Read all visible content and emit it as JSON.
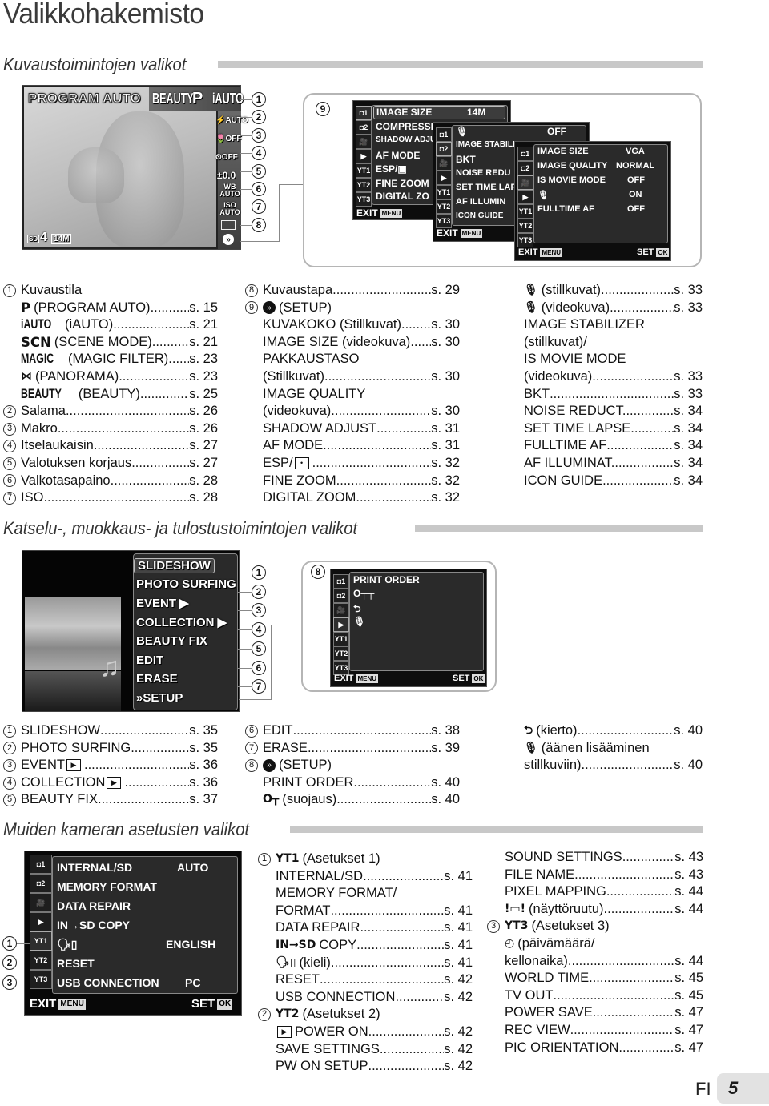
{
  "page_title": "Valikkohakemisto",
  "sections": {
    "shooting": "Kuvaustoimintojen valikot",
    "playback": "Katselu-, muokkaus- ja tulostustoimintojen valikot",
    "settings": "Muiden kameran asetusten valikot"
  },
  "shooting_screen": {
    "mode_label": "PROGRAM AUTO",
    "mode_icons": [
      "BEAUTY",
      "P",
      "iAUTO"
    ],
    "side_items": [
      "⚡AUTO",
      "🌷OFF",
      "⏲OFF",
      "±0.0",
      "WB AUTO",
      "ISO AUTO",
      "▭",
      "»"
    ],
    "bottom_status": [
      "SD",
      "4",
      "14M"
    ],
    "callouts": [
      "1",
      "2",
      "3",
      "4",
      "5",
      "6",
      "7",
      "8"
    ]
  },
  "setup_menus": {
    "callout": "9",
    "tabs": [
      "◘1",
      "◘2",
      "🎥",
      "▶",
      "YT1",
      "YT2",
      "YT3"
    ],
    "menu1": {
      "rows": [
        {
          "label": "IMAGE SIZE",
          "value": "14M"
        },
        {
          "label": "COMPRESSI",
          "value": ""
        },
        {
          "label": "SHADOW ADJU",
          "value": ""
        },
        {
          "label": "AF MODE",
          "value": ""
        },
        {
          "label": "ESP/▣",
          "value": ""
        },
        {
          "label": "FINE ZOOM",
          "value": ""
        },
        {
          "label": "DIGITAL ZO",
          "value": ""
        }
      ],
      "exit": "EXIT",
      "menu_key": "MENU"
    },
    "menu2": {
      "rows": [
        {
          "label": "🎙",
          "value": "OFF"
        },
        {
          "label": "IMAGE STABILD",
          "value": ""
        },
        {
          "label": "BKT",
          "value": ""
        },
        {
          "label": "NOISE REDU",
          "value": ""
        },
        {
          "label": "SET TIME LAF",
          "value": ""
        },
        {
          "label": "AF ILLUMIN",
          "value": ""
        },
        {
          "label": "ICON GUIDE",
          "value": ""
        }
      ],
      "exit": "EXIT",
      "menu_key": "MENU"
    },
    "menu3": {
      "rows": [
        {
          "label": "IMAGE SIZE",
          "value": "VGA"
        },
        {
          "label": "IMAGE QUALITY",
          "value": "NORMAL"
        },
        {
          "label": "IS MOVIE MODE",
          "value": "OFF"
        },
        {
          "label": "🎙",
          "value": "ON"
        },
        {
          "label": "FULLTIME AF",
          "value": "OFF"
        }
      ],
      "exit": "EXIT",
      "menu_key": "MENU",
      "set": "SET",
      "ok_key": "OK"
    }
  },
  "shooting_refs": {
    "col1": [
      {
        "num": "1",
        "label": "Kuvaustila",
        "page": ""
      },
      {
        "icon": "P",
        "label": "(PROGRAM AUTO)",
        "page": "s. 15"
      },
      {
        "icon": "iAUTO",
        "label": "(iAUTO)",
        "page": "s. 21"
      },
      {
        "icon": "SCN",
        "label": "(SCENE MODE)",
        "page": "s. 21"
      },
      {
        "icon": "MAGIC",
        "label": "(MAGIC FILTER)",
        "page": "s. 23"
      },
      {
        "icon": "⋈",
        "label": "(PANORAMA)",
        "page": "s. 23"
      },
      {
        "icon": "BEAUTY",
        "label": "(BEAUTY)",
        "page": "s. 25"
      },
      {
        "num": "2",
        "label": "Salama",
        "page": "s. 26"
      },
      {
        "num": "3",
        "label": "Makro",
        "page": "s. 26"
      },
      {
        "num": "4",
        "label": "Itselaukaisin",
        "page": "s. 27"
      },
      {
        "num": "5",
        "label": "Valotuksen korjaus",
        "page": "s. 27"
      },
      {
        "num": "6",
        "label": "Valkotasapaino",
        "page": "s. 28"
      },
      {
        "num": "7",
        "label": "ISO",
        "page": "s. 28"
      }
    ],
    "col2": [
      {
        "num": "8",
        "label": "Kuvaustapa",
        "page": "s. 29"
      },
      {
        "num": "9",
        "icon": "»",
        "label": "(SETUP)",
        "page": ""
      },
      {
        "label": "KUVAKOKO (Stillkuvat)",
        "page": "s. 30"
      },
      {
        "label": "IMAGE SIZE (videokuva)",
        "page": "s. 30"
      },
      {
        "label": "PAKKAUSTASO",
        "page": ""
      },
      {
        "label": "(Stillkuvat)",
        "page": "s. 30"
      },
      {
        "label": "IMAGE QUALITY",
        "page": ""
      },
      {
        "label": "(videokuva)",
        "page": "s. 30"
      },
      {
        "label": "SHADOW ADJUST",
        "page": "s. 31"
      },
      {
        "label": "AF MODE",
        "page": "s. 31"
      },
      {
        "label": "ESP/",
        "icon_after": "•",
        "page": "s. 32"
      },
      {
        "label": "FINE ZOOM",
        "page": "s. 32"
      },
      {
        "label": "DIGITAL ZOOM",
        "page": "s. 32"
      }
    ],
    "col3": [
      {
        "icon": "🎙",
        "label": "(stillkuvat)",
        "page": "s. 33"
      },
      {
        "icon": "🎙",
        "label": "(videokuva)",
        "page": "s. 33"
      },
      {
        "label": "IMAGE STABILIZER",
        "page": ""
      },
      {
        "label": "(stillkuvat)/",
        "page": ""
      },
      {
        "label": "IS MOVIE MODE",
        "page": ""
      },
      {
        "label": "(videokuva)",
        "page": "s. 33"
      },
      {
        "label": "BKT",
        "page": "s. 33"
      },
      {
        "label": "NOISE REDUCT.",
        "page": "s. 34"
      },
      {
        "label": "SET TIME LAPSE",
        "page": "s. 34"
      },
      {
        "label": "FULLTIME AF",
        "page": "s. 34"
      },
      {
        "label": "AF ILLUMINAT.",
        "page": "s. 34"
      },
      {
        "label": "ICON GUIDE",
        "page": "s. 34"
      }
    ]
  },
  "playback_screen": {
    "items": [
      "SLIDESHOW",
      "PHOTO SURFING",
      "EVENT ▶",
      "COLLECTION ▶",
      "BEAUTY FIX",
      "EDIT",
      "ERASE",
      "»SETUP"
    ],
    "callouts": [
      "1",
      "2",
      "3",
      "4",
      "5",
      "6",
      "7"
    ]
  },
  "playback_setup_menu": {
    "callout": "8",
    "tabs": [
      "◘1",
      "◘2",
      "🎥",
      "▶",
      "YT1",
      "YT2",
      "YT3"
    ],
    "rows": [
      "PRINT ORDER",
      "O┬┬",
      "⮌",
      "🎙"
    ],
    "exit": "EXIT",
    "menu_key": "MENU",
    "set": "SET",
    "ok_key": "OK"
  },
  "playback_refs": {
    "col1": [
      {
        "num": "1",
        "label": "SLIDESHOW",
        "page": "s. 35"
      },
      {
        "num": "2",
        "label": "PHOTO SURFING",
        "page": "s. 35"
      },
      {
        "num": "3",
        "label": "EVENT",
        "icon_after": "▶",
        "page": "s. 36"
      },
      {
        "num": "4",
        "label": "COLLECTION",
        "icon_after": "▶",
        "page": "s. 36"
      },
      {
        "num": "5",
        "label": "BEAUTY FIX",
        "page": "s. 37"
      }
    ],
    "col2": [
      {
        "num": "6",
        "label": "EDIT",
        "page": "s. 38"
      },
      {
        "num": "7",
        "label": "ERASE",
        "page": "s. 39"
      },
      {
        "num": "8",
        "icon": "»",
        "label": "(SETUP)",
        "page": ""
      },
      {
        "label": "PRINT ORDER",
        "page": "s. 40"
      },
      {
        "icon": "O┳",
        "label": "(suojaus)",
        "page": "s. 40"
      }
    ],
    "col3": [
      {
        "icon": "⮌",
        "label": "(kierto)",
        "page": "s. 40"
      },
      {
        "icon": "🎙",
        "label": "(äänen lisääminen",
        "page": ""
      },
      {
        "label": "stillkuviin)",
        "page": "s. 40"
      }
    ]
  },
  "settings_menu": {
    "tabs": [
      "◘1",
      "◘2",
      "🎥",
      "▶",
      "YT1",
      "YT2",
      "YT3"
    ],
    "callouts": [
      "1",
      "2",
      "3"
    ],
    "rows": [
      {
        "label": "INTERNAL/SD",
        "value": "AUTO"
      },
      {
        "label": "MEMORY FORMAT",
        "value": ""
      },
      {
        "label": "DATA REPAIR",
        "value": ""
      },
      {
        "label": "IN→SD COPY",
        "value": ""
      },
      {
        "label": "🗣▯",
        "value": "ENGLISH"
      },
      {
        "label": "RESET",
        "value": ""
      },
      {
        "label": "USB CONNECTION",
        "value": "PC"
      }
    ],
    "exit": "EXIT",
    "menu_key": "MENU",
    "set": "SET",
    "ok_key": "OK"
  },
  "settings_refs": {
    "col2": [
      {
        "num": "1",
        "icon": "YT1",
        "label": "(Asetukset 1)",
        "page": ""
      },
      {
        "label": "INTERNAL/SD",
        "page": "s. 41"
      },
      {
        "label": "MEMORY FORMAT/",
        "page": ""
      },
      {
        "label": "FORMAT",
        "page": "s. 41"
      },
      {
        "label": "DATA REPAIR",
        "page": "s. 41"
      },
      {
        "icon": "IN→SD",
        "label": "COPY",
        "page": "s. 41"
      },
      {
        "icon": "🗣▯",
        "label": "(kieli)",
        "page": "s. 41"
      },
      {
        "label": "RESET",
        "page": "s. 42"
      },
      {
        "label": "USB CONNECTION",
        "page": "s. 42"
      },
      {
        "num": "2",
        "icon": "YT2",
        "label": "(Asetukset 2)",
        "page": ""
      },
      {
        "icon": "▶",
        "label": "POWER ON",
        "page": "s. 42"
      },
      {
        "label": "SAVE SETTINGS",
        "page": "s. 42"
      },
      {
        "label": "PW ON SETUP",
        "page": "s. 42"
      }
    ],
    "col3": [
      {
        "label": "SOUND SETTINGS",
        "page": "s. 43"
      },
      {
        "label": "FILE NAME",
        "page": "s. 43"
      },
      {
        "label": "PIXEL MAPPING",
        "page": "s. 44"
      },
      {
        "icon": "!▭!",
        "label": "(näyttöruutu)",
        "page": "s. 44"
      },
      {
        "num": "3",
        "icon": "YT3",
        "label": "(Asetukset 3)",
        "page": ""
      },
      {
        "icon": "◴",
        "label": "(päivämäärä/",
        "page": ""
      },
      {
        "label": "kellonaika)",
        "page": "s. 44"
      },
      {
        "label": "WORLD TIME",
        "page": "s. 45"
      },
      {
        "label": "TV OUT",
        "page": "s. 45"
      },
      {
        "label": "POWER SAVE",
        "page": "s. 47"
      },
      {
        "label": "REC VIEW",
        "page": "s. 47"
      },
      {
        "label": "PIC ORIENTATION",
        "page": "s. 47"
      }
    ]
  },
  "footer": {
    "language": "FI",
    "page_number": "5"
  }
}
